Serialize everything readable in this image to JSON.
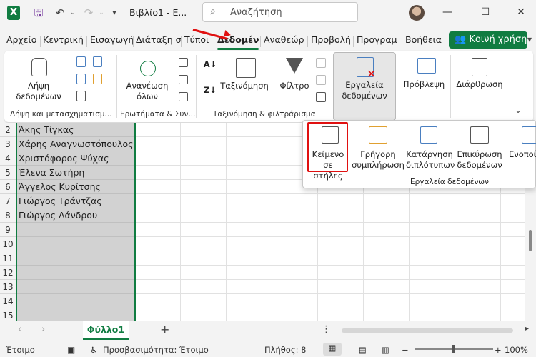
{
  "titlebar": {
    "app_logo": "X",
    "save_icon": "save-icon",
    "undo_icon": "undo-icon",
    "redo_icon": "redo-icon",
    "title": "Βιβλίο1 - E...",
    "search_placeholder": "Αναζήτηση",
    "window_buttons": {
      "minimize": "—",
      "maximize": "☐",
      "close": "✕"
    }
  },
  "tabs": [
    "Αρχείο",
    "Κεντρική",
    "Εισαγωγή",
    "Διάταξη σ",
    "Τύποι",
    "Δεδομένα",
    "Αναθεώρ",
    "Προβολή",
    "Προγραμ",
    "Βοήθεια"
  ],
  "active_tab": "Δεδομένα",
  "share_label": "Κοινή χρήση",
  "ribbon": {
    "get_data": "Λήψη\nδεδομένων",
    "refresh_all": "Ανανέωση\nόλων",
    "sort": "Ταξινόμηση",
    "filter": "Φίλτρο",
    "data_tools": "Εργαλεία\nδεδομένων",
    "forecast": "Πρόβλεψη",
    "outline": "Διάρθρωση",
    "group_get_transform": "Λήψη και μετασχηματισμ...",
    "group_queries": "Ερωτήματα & Συν...",
    "group_sort_filter": "Ταξινόμηση & φιλτράρισμα"
  },
  "dropdown": {
    "text_to_columns": "Κείμενο\nσε στήλες",
    "flash_fill": "Γρήγορη\nσυμπλήρωση",
    "remove_duplicates": "Κατάργηση\nδιπλότυπων",
    "data_validation": "Επικύρωση\nδεδομένων",
    "consolidate": "Ενοποί",
    "group_label": "Εργαλεία δεδομένων"
  },
  "sheet": {
    "rows": [
      {
        "num": "2",
        "a": "Άκης Τίγκας"
      },
      {
        "num": "3",
        "a": "Χάρης  Αναγνωστόπουλος"
      },
      {
        "num": "4",
        "a": "Χριστόφορος Ψύχας"
      },
      {
        "num": "5",
        "a": "Έλενα Σωτήρη"
      },
      {
        "num": "6",
        "a": "Άγγελος Κυρίτσης"
      },
      {
        "num": "7",
        "a": "Γιώργος Τράντζας"
      },
      {
        "num": "8",
        "a": "Γιώργος Λάνδρου"
      },
      {
        "num": "9",
        "a": ""
      },
      {
        "num": "10",
        "a": ""
      },
      {
        "num": "11",
        "a": ""
      },
      {
        "num": "12",
        "a": ""
      },
      {
        "num": "13",
        "a": ""
      },
      {
        "num": "14",
        "a": ""
      },
      {
        "num": "15",
        "a": ""
      }
    ]
  },
  "sheet_tab": "Φύλλο1",
  "statusbar": {
    "ready": "Έτοιμο",
    "accessibility": "Προσβασιμότητα: Έτοιμο",
    "count": "Πλήθος: 8",
    "zoom": "100%"
  },
  "colors": {
    "accent": "#107c41",
    "highlight": "#e01010"
  }
}
